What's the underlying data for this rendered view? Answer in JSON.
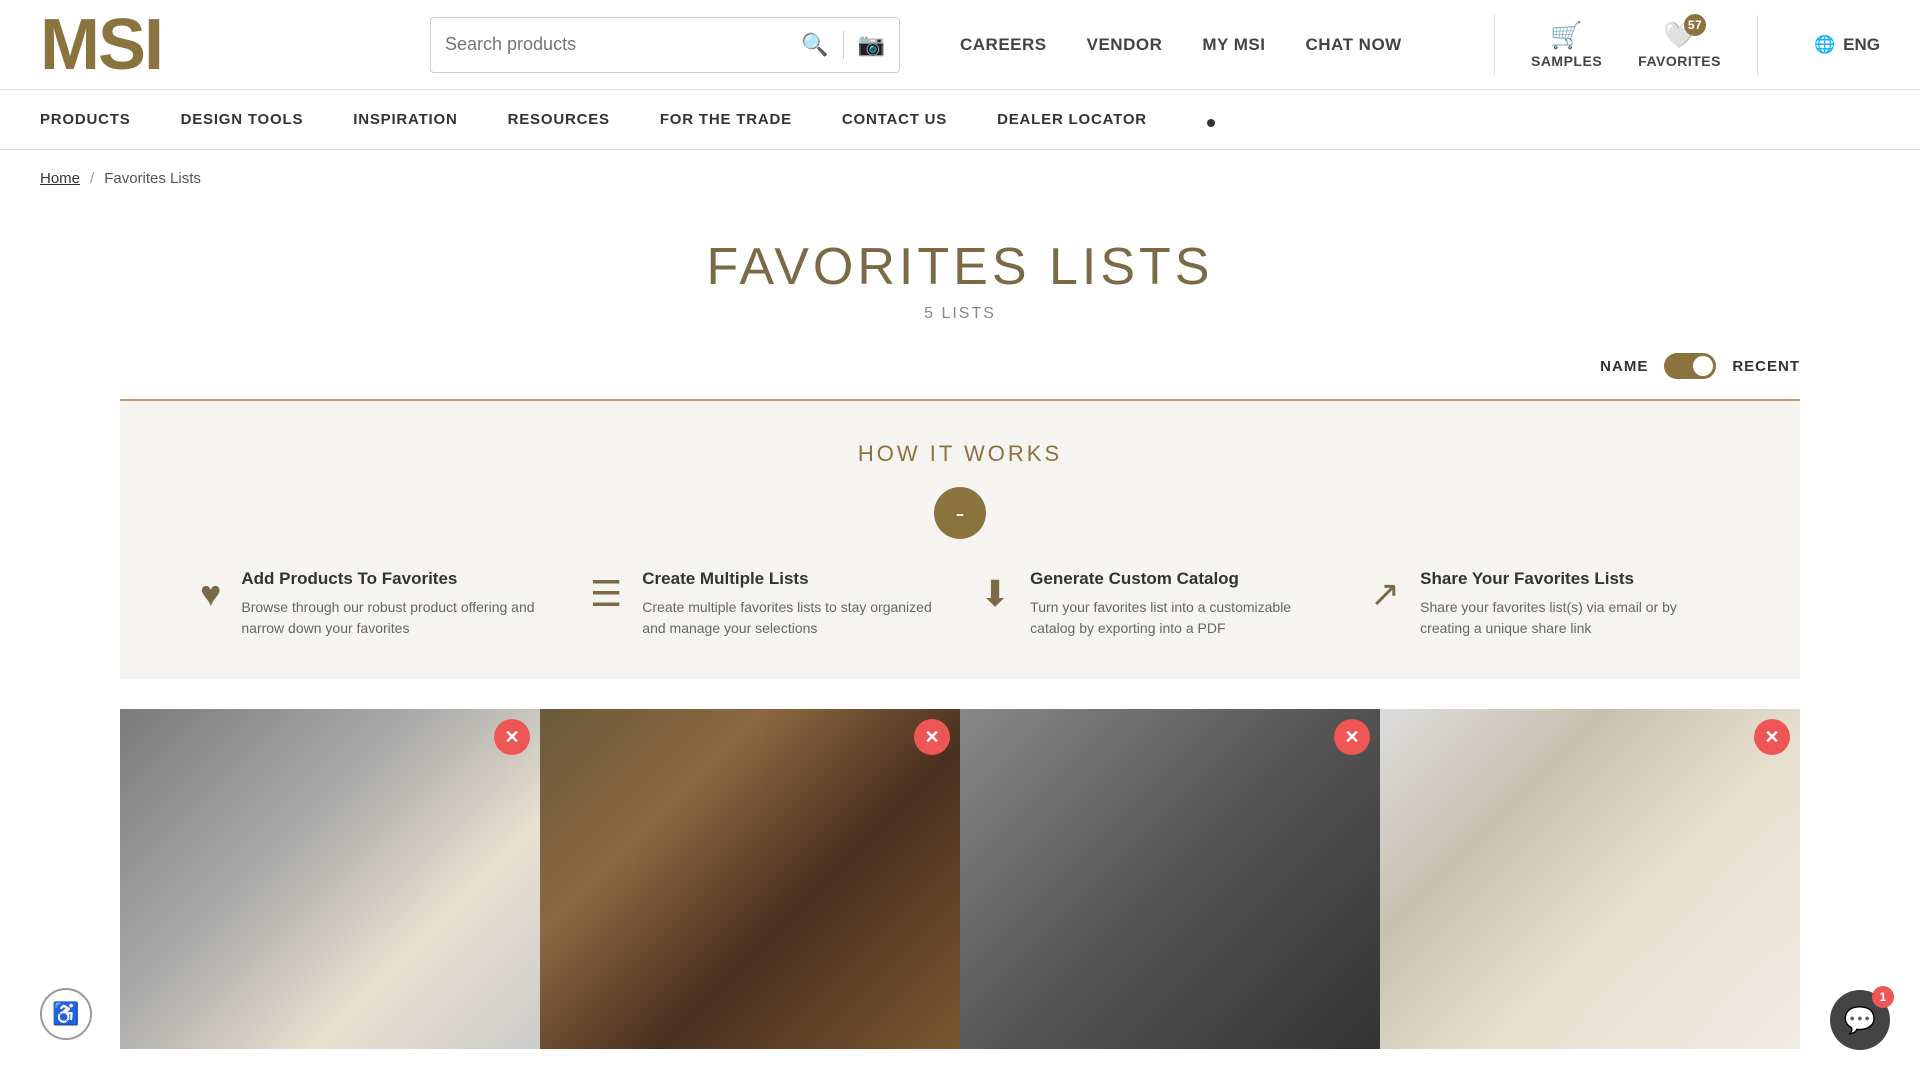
{
  "header": {
    "logo": "MSI",
    "search_placeholder": "Search products",
    "top_nav": [
      {
        "label": "CAREERS",
        "id": "careers"
      },
      {
        "label": "VENDOR",
        "id": "vendor"
      },
      {
        "label": "MY MSI",
        "id": "my-msi"
      },
      {
        "label": "CHAT NOW",
        "id": "chat-now"
      }
    ],
    "samples_label": "SAMPLES",
    "favorites_label": "FAVORITES",
    "favorites_count": "57",
    "lang_label": "ENG"
  },
  "main_nav": [
    {
      "label": "PRODUCTS",
      "id": "products"
    },
    {
      "label": "DESIGN TOOLS",
      "id": "design-tools"
    },
    {
      "label": "INSPIRATION",
      "id": "inspiration"
    },
    {
      "label": "RESOURCES",
      "id": "resources"
    },
    {
      "label": "FOR THE TRADE",
      "id": "for-the-trade"
    },
    {
      "label": "CONTACT US",
      "id": "contact-us"
    },
    {
      "label": "DEALER LOCATOR",
      "id": "dealer-locator"
    }
  ],
  "breadcrumb": {
    "home": "Home",
    "separator": "/",
    "current": "Favorites Lists"
  },
  "page": {
    "title": "FAVORITES LISTS",
    "lists_count": "5 LISTS",
    "sort_name": "NAME",
    "sort_recent": "RECENT"
  },
  "how_it_works": {
    "title": "HOW IT WORKS",
    "collapse_symbol": "-",
    "items": [
      {
        "id": "add-favorites",
        "icon": "♥",
        "title": "Add Products To Favorites",
        "description": "Browse through our robust product offering and narrow down your favorites"
      },
      {
        "id": "create-lists",
        "icon": "☰",
        "title": "Create Multiple Lists",
        "description": "Create multiple favorites lists to stay organized and manage your selections"
      },
      {
        "id": "generate-catalog",
        "icon": "⬇",
        "title": "Generate Custom Catalog",
        "description": "Turn your favorites list into a customizable catalog by exporting into a PDF"
      },
      {
        "id": "share-lists",
        "icon": "↗",
        "title": "Share Your Favorites Lists",
        "description": "Share your favorites list(s) via email or by creating a unique share link"
      }
    ]
  },
  "tiles": [
    {
      "id": "tile-1",
      "class": "tile-1"
    },
    {
      "id": "tile-2",
      "class": "tile-2"
    },
    {
      "id": "tile-3",
      "class": "tile-3"
    },
    {
      "id": "tile-4",
      "class": "tile-4"
    }
  ],
  "close_symbol": "✕",
  "chat_badge": "1",
  "accessibility_icon": "♿"
}
